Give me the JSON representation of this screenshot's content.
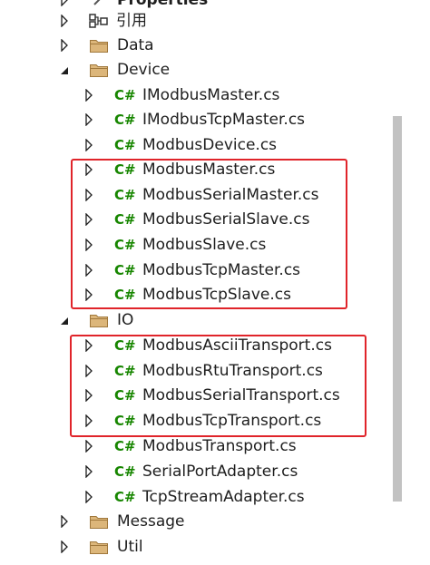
{
  "tree": {
    "items": [
      {
        "label": "Properties",
        "icon": "wrench-icon",
        "expanded": false
      },
      {
        "label": "引用",
        "icon": "references-icon",
        "expanded": false
      },
      {
        "label": "Data",
        "icon": "folder-icon",
        "expanded": false
      },
      {
        "label": "Device",
        "icon": "folder-icon",
        "expanded": true
      },
      {
        "label": "IModbusMaster.cs",
        "icon": "csharp-file-icon",
        "icon_text": "C#"
      },
      {
        "label": "IModbusTcpMaster.cs",
        "icon": "csharp-file-icon",
        "icon_text": "C#"
      },
      {
        "label": "ModbusDevice.cs",
        "icon": "csharp-file-icon",
        "icon_text": "C#"
      },
      {
        "label": "ModbusMaster.cs",
        "icon": "csharp-file-icon",
        "icon_text": "C#"
      },
      {
        "label": "ModbusSerialMaster.cs",
        "icon": "csharp-file-icon",
        "icon_text": "C#"
      },
      {
        "label": "ModbusSerialSlave.cs",
        "icon": "csharp-file-icon",
        "icon_text": "C#"
      },
      {
        "label": "ModbusSlave.cs",
        "icon": "csharp-file-icon",
        "icon_text": "C#"
      },
      {
        "label": "ModbusTcpMaster.cs",
        "icon": "csharp-file-icon",
        "icon_text": "C#"
      },
      {
        "label": "ModbusTcpSlave.cs",
        "icon": "csharp-file-icon",
        "icon_text": "C#"
      },
      {
        "label": "IO",
        "icon": "folder-icon",
        "expanded": true
      },
      {
        "label": "ModbusAsciiTransport.cs",
        "icon": "csharp-file-icon",
        "icon_text": "C#"
      },
      {
        "label": "ModbusRtuTransport.cs",
        "icon": "csharp-file-icon",
        "icon_text": "C#"
      },
      {
        "label": "ModbusSerialTransport.cs",
        "icon": "csharp-file-icon",
        "icon_text": "C#"
      },
      {
        "label": "ModbusTcpTransport.cs",
        "icon": "csharp-file-icon",
        "icon_text": "C#"
      },
      {
        "label": "ModbusTransport.cs",
        "icon": "csharp-file-icon",
        "icon_text": "C#"
      },
      {
        "label": "SerialPortAdapter.cs",
        "icon": "csharp-file-icon",
        "icon_text": "C#"
      },
      {
        "label": "TcpStreamAdapter.cs",
        "icon": "csharp-file-icon",
        "icon_text": "C#"
      },
      {
        "label": "Message",
        "icon": "folder-icon",
        "expanded": false
      },
      {
        "label": "Util",
        "icon": "folder-icon",
        "expanded": false
      }
    ]
  },
  "colors": {
    "csharp_icon": "#178600",
    "folder_fill": "#dcb67a",
    "folder_stroke": "#a0783c",
    "highlight": "#e0242a",
    "scrollbar_thumb": "#c2c2c2"
  }
}
